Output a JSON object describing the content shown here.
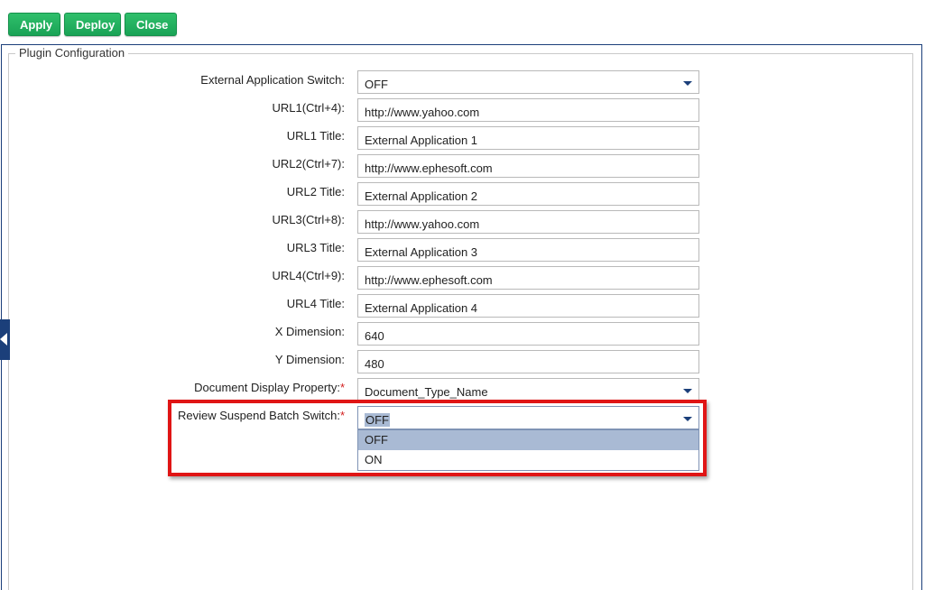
{
  "toolbar": {
    "apply_label": "Apply",
    "deploy_label": "Deploy",
    "close_label": "Close"
  },
  "panel": {
    "legend": "Plugin Configuration"
  },
  "fields": [
    {
      "label": "External Application Switch:",
      "value": "OFF",
      "type": "select"
    },
    {
      "label": "URL1(Ctrl+4):",
      "value": "http://www.yahoo.com",
      "type": "text"
    },
    {
      "label": "URL1 Title:",
      "value": "External Application 1",
      "type": "text"
    },
    {
      "label": "URL2(Ctrl+7):",
      "value": "http://www.ephesoft.com",
      "type": "text"
    },
    {
      "label": "URL2 Title:",
      "value": "External Application 2",
      "type": "text"
    },
    {
      "label": "URL3(Ctrl+8):",
      "value": "http://www.yahoo.com",
      "type": "text"
    },
    {
      "label": "URL3 Title:",
      "value": "External Application 3",
      "type": "text"
    },
    {
      "label": "URL4(Ctrl+9):",
      "value": "http://www.ephesoft.com",
      "type": "text"
    },
    {
      "label": "URL4 Title:",
      "value": "External Application 4",
      "type": "text"
    },
    {
      "label": "X Dimension:",
      "value": "640",
      "type": "text"
    },
    {
      "label": "Y Dimension:",
      "value": "480",
      "type": "text"
    },
    {
      "label": "Document Display Property:",
      "required_mark": "*",
      "value": "Document_Type_Name",
      "type": "select"
    },
    {
      "label": "Review Suspend Batch Switch:",
      "required_mark": "*",
      "value": "OFF",
      "type": "select"
    }
  ],
  "dropdown": {
    "options": [
      "OFF",
      "ON"
    ],
    "active_option": "OFF"
  },
  "colors": {
    "button_green": "#1aa356",
    "panel_border": "#1b3f7a",
    "highlight_red": "#e01515",
    "selection": "#a9bad4"
  }
}
